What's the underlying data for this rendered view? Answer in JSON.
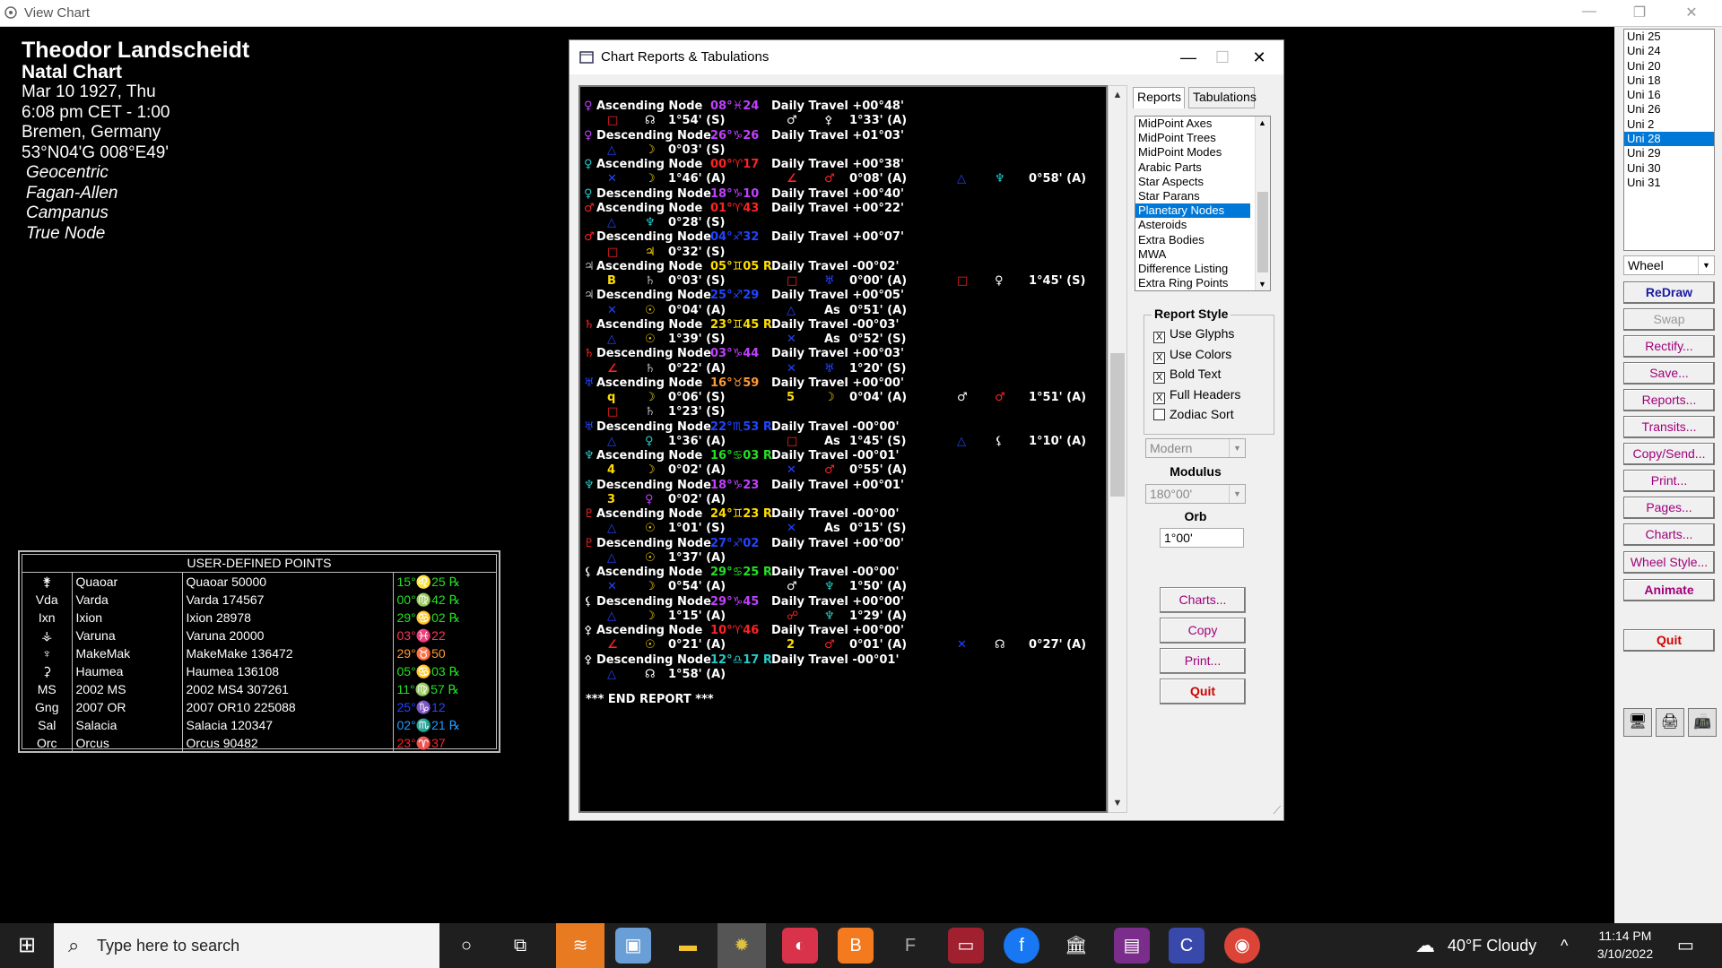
{
  "window": {
    "title": "View Chart"
  },
  "chart_info": {
    "name": "Theodor Landscheidt",
    "type": "Natal Chart",
    "date": "Mar 10 1927, Thu",
    "time": "6:08 pm  CET - 1:00",
    "place": "Bremen, Germany",
    "coords": "53°N04'G 008°E49'",
    "options": [
      "Geocentric",
      "Fagan-Allen",
      "Campanus",
      "True Node"
    ]
  },
  "udp": {
    "header": "USER-DEFINED POINTS",
    "rows": [
      {
        "abbr": "⚵",
        "name": "Quaoar",
        "full": "Quaoar 50000",
        "pos": "15°♌25 ℞",
        "color": "#22e022"
      },
      {
        "abbr": "Vda",
        "name": "Varda",
        "full": "Varda 174567",
        "pos": "00°♍42 ℞",
        "color": "#22e022"
      },
      {
        "abbr": "Ixn",
        "name": "Ixion",
        "full": "Ixion 28978",
        "pos": "29°♋02 ℞",
        "color": "#22e022"
      },
      {
        "abbr": "⚶",
        "name": "Varuna",
        "full": "Varuna 20000",
        "pos": "03°♓22",
        "color": "#ff3355"
      },
      {
        "abbr": "♆",
        "name": "MakeMak",
        "full": "MakeMake 136472",
        "pos": "29°♉50",
        "color": "#ff9933"
      },
      {
        "abbr": "⚳",
        "name": "Haumea",
        "full": "Haumea 136108",
        "pos": "05°♋03 ℞",
        "color": "#22e022"
      },
      {
        "abbr": "MS",
        "name": "2002 MS",
        "full": "2002 MS4 307261",
        "pos": "11°♍57 ℞",
        "color": "#22e022"
      },
      {
        "abbr": "Gng",
        "name": "2007 OR",
        "full": "2007 OR10 225088",
        "pos": "25°♑12",
        "color": "#2244ff"
      },
      {
        "abbr": "Sal",
        "name": "Salacia",
        "full": "Salacia 120347",
        "pos": "02°♏21 ℞",
        "color": "#2299ff"
      },
      {
        "abbr": "Orc",
        "name": "Orcus",
        "full": "Orcus 90482",
        "pos": "23°♈37",
        "color": "#ff2222"
      }
    ]
  },
  "dialog": {
    "title": "Chart Reports & Tabulations",
    "tabs": [
      "Reports",
      "Tabulations"
    ],
    "report_types": [
      "MidPoint Axes",
      "MidPoint Trees",
      "MidPoint Modes",
      "Arabic Parts",
      "Star Aspects",
      "Star Parans",
      "Planetary Nodes",
      "Asteroids",
      "Extra Bodies",
      "MWA",
      "Difference Listing",
      "Extra Ring Points"
    ],
    "selected_report": "Planetary Nodes",
    "report_style_title": "Report Style",
    "checkboxes": [
      {
        "label": "Use Glyphs",
        "checked": "X"
      },
      {
        "label": "Use Colors",
        "checked": "X"
      },
      {
        "label": "Bold Text",
        "checked": "X"
      },
      {
        "label": "Full Headers",
        "checked": "X"
      },
      {
        "label": "Zodiac Sort",
        "checked": ""
      }
    ],
    "style_combo": "Modern",
    "modulus_label": "Modulus",
    "modulus_value": "180°00'",
    "orb_label": "Orb",
    "orb_value": "1°00'",
    "buttons": [
      "Charts...",
      "Copy",
      "Print...",
      "Quit"
    ],
    "end_text": "*** END REPORT ***"
  },
  "report_rows": [
    [
      {
        "t": "♀",
        "c": "#c040ff"
      },
      {
        "t": "Ascending Node",
        "c": "#fff"
      },
      {
        "t": "08°♓24",
        "c": "#c040ff"
      },
      {
        "t": "Daily Travel +00°48'",
        "c": "#fff"
      }
    ],
    [
      {
        "t": "□",
        "c": "#ff2222"
      },
      {
        "t": "☊",
        "c": "#fff"
      },
      {
        "t": "1°54' (S)",
        "c": "#fff"
      },
      {
        "t": "♂",
        "c": "#fff"
      },
      {
        "t": "⚴",
        "c": "#fff"
      },
      {
        "t": "1°33' (A)",
        "c": "#fff"
      }
    ],
    [
      {
        "t": "♀",
        "c": "#c040ff"
      },
      {
        "t": "Descending Node",
        "c": "#fff"
      },
      {
        "t": "26°♑26",
        "c": "#c040ff"
      },
      {
        "t": "Daily Travel +01°03'",
        "c": "#fff"
      }
    ],
    [
      {
        "t": "△",
        "c": "#2244ff"
      },
      {
        "t": "☽",
        "c": "#ffdd00"
      },
      {
        "t": "0°03' (S)",
        "c": "#fff"
      }
    ],
    [
      {
        "t": "♀",
        "c": "#22cccc"
      },
      {
        "t": "Ascending Node",
        "c": "#fff"
      },
      {
        "t": "00°♈17",
        "c": "#ff2222"
      },
      {
        "t": "Daily Travel +00°38'",
        "c": "#fff"
      }
    ],
    [
      {
        "t": "✕",
        "c": "#2244ff"
      },
      {
        "t": "☽",
        "c": "#ffdd00"
      },
      {
        "t": "1°46' (A)",
        "c": "#fff"
      },
      {
        "t": "∠",
        "c": "#ff2222"
      },
      {
        "t": "♂",
        "c": "#ff2222"
      },
      {
        "t": "0°08' (A)",
        "c": "#fff"
      },
      {
        "t": "△",
        "c": "#2244ff"
      },
      {
        "t": "♆",
        "c": "#22cccc"
      },
      {
        "t": "0°58' (A)",
        "c": "#fff"
      }
    ],
    [
      {
        "t": "♀",
        "c": "#22cccc"
      },
      {
        "t": "Descending Node",
        "c": "#fff"
      },
      {
        "t": "18°♑10",
        "c": "#c040ff"
      },
      {
        "t": "Daily Travel +00°40'",
        "c": "#fff"
      }
    ],
    [
      {
        "t": "♂",
        "c": "#ff2222"
      },
      {
        "t": "Ascending Node",
        "c": "#fff"
      },
      {
        "t": "01°♈43",
        "c": "#ff2222"
      },
      {
        "t": "Daily Travel +00°22'",
        "c": "#fff"
      }
    ],
    [
      {
        "t": "△",
        "c": "#2244ff"
      },
      {
        "t": "♆",
        "c": "#22cccc"
      },
      {
        "t": "0°28' (S)",
        "c": "#fff"
      }
    ],
    [
      {
        "t": "♂",
        "c": "#ff2222"
      },
      {
        "t": "Descending Node",
        "c": "#fff"
      },
      {
        "t": "04°♐32",
        "c": "#2244ff"
      },
      {
        "t": "Daily Travel +00°07'",
        "c": "#fff"
      }
    ],
    [
      {
        "t": "□",
        "c": "#ff2222"
      },
      {
        "t": "♃",
        "c": "#ffdd00"
      },
      {
        "t": "0°32' (S)",
        "c": "#fff"
      }
    ],
    [
      {
        "t": "♃",
        "c": "#bbbbbb"
      },
      {
        "t": "Ascending Node",
        "c": "#fff"
      },
      {
        "t": "05°♊05 R",
        "c": "#ffdd00"
      },
      {
        "t": "Daily Travel -00°02'",
        "c": "#fff"
      }
    ],
    [
      {
        "t": "B",
        "c": "#ffdd00"
      },
      {
        "t": "♄",
        "c": "#bbbbbb"
      },
      {
        "t": "0°03' (S)",
        "c": "#fff"
      },
      {
        "t": "□",
        "c": "#ff2222"
      },
      {
        "t": "♅",
        "c": "#2244ff"
      },
      {
        "t": "0°00' (A)",
        "c": "#fff"
      },
      {
        "t": "□",
        "c": "#ff2222"
      },
      {
        "t": "♀",
        "c": "#fff"
      },
      {
        "t": "1°45' (S)",
        "c": "#fff"
      }
    ],
    [
      {
        "t": "♃",
        "c": "#bbbbbb"
      },
      {
        "t": "Descending Node",
        "c": "#fff"
      },
      {
        "t": "25°♐29",
        "c": "#2244ff"
      },
      {
        "t": "Daily Travel +00°05'",
        "c": "#fff"
      }
    ],
    [
      {
        "t": "✕",
        "c": "#2244ff"
      },
      {
        "t": "☉",
        "c": "#ffdd00"
      },
      {
        "t": "0°04' (A)",
        "c": "#fff"
      },
      {
        "t": "△",
        "c": "#2244ff"
      },
      {
        "t": "As",
        "c": "#fff"
      },
      {
        "t": "0°51' (A)",
        "c": "#fff"
      }
    ],
    [
      {
        "t": "♄",
        "c": "#ff2222"
      },
      {
        "t": "Ascending Node",
        "c": "#fff"
      },
      {
        "t": "23°♊45 R",
        "c": "#ffdd00"
      },
      {
        "t": "Daily Travel -00°03'",
        "c": "#fff"
      }
    ],
    [
      {
        "t": "△",
        "c": "#2244ff"
      },
      {
        "t": "☉",
        "c": "#ffdd00"
      },
      {
        "t": "1°39' (S)",
        "c": "#fff"
      },
      {
        "t": "✕",
        "c": "#2244ff"
      },
      {
        "t": "As",
        "c": "#fff"
      },
      {
        "t": "0°52' (S)",
        "c": "#fff"
      }
    ],
    [
      {
        "t": "♄",
        "c": "#ff2222"
      },
      {
        "t": "Descending Node",
        "c": "#fff"
      },
      {
        "t": "03°♑44",
        "c": "#c040ff"
      },
      {
        "t": "Daily Travel +00°03'",
        "c": "#fff"
      }
    ],
    [
      {
        "t": "∠",
        "c": "#ff2222"
      },
      {
        "t": "♄",
        "c": "#bbbbbb"
      },
      {
        "t": "0°22' (A)",
        "c": "#fff"
      },
      {
        "t": "✕",
        "c": "#2244ff"
      },
      {
        "t": "♅",
        "c": "#2244ff"
      },
      {
        "t": "1°20' (S)",
        "c": "#fff"
      }
    ],
    [
      {
        "t": "♅",
        "c": "#2244ff"
      },
      {
        "t": "Ascending Node",
        "c": "#fff"
      },
      {
        "t": "16°♉59",
        "c": "#ff9933"
      },
      {
        "t": "Daily Travel +00°00'",
        "c": "#fff"
      }
    ],
    [
      {
        "t": "q",
        "c": "#ffdd00"
      },
      {
        "t": "☽",
        "c": "#ffdd00"
      },
      {
        "t": "0°06' (S)",
        "c": "#fff"
      },
      {
        "t": "5",
        "c": "#ffdd00"
      },
      {
        "t": "☽",
        "c": "#ffdd00"
      },
      {
        "t": "0°04' (A)",
        "c": "#fff"
      },
      {
        "t": "♂",
        "c": "#fff"
      },
      {
        "t": "♂",
        "c": "#ff2222"
      },
      {
        "t": "1°51' (A)",
        "c": "#fff"
      }
    ],
    [
      {
        "t": "□",
        "c": "#ff2222"
      },
      {
        "t": "♄",
        "c": "#bbbbbb"
      },
      {
        "t": "1°23' (S)",
        "c": "#fff"
      }
    ],
    [
      {
        "t": "♅",
        "c": "#2244ff"
      },
      {
        "t": "Descending Node",
        "c": "#fff"
      },
      {
        "t": "22°♏53 R",
        "c": "#2244ff"
      },
      {
        "t": "Daily Travel -00°00'",
        "c": "#fff"
      }
    ],
    [
      {
        "t": "△",
        "c": "#2244ff"
      },
      {
        "t": "♀",
        "c": "#22cccc"
      },
      {
        "t": "1°36' (A)",
        "c": "#fff"
      },
      {
        "t": "□",
        "c": "#ff2222"
      },
      {
        "t": "As",
        "c": "#fff"
      },
      {
        "t": "1°45' (S)",
        "c": "#fff"
      },
      {
        "t": "△",
        "c": "#2244ff"
      },
      {
        "t": "⚸",
        "c": "#fff"
      },
      {
        "t": "1°10' (A)",
        "c": "#fff"
      }
    ],
    [
      {
        "t": "♆",
        "c": "#22cccc"
      },
      {
        "t": "Ascending Node",
        "c": "#fff"
      },
      {
        "t": "16°♋03 R",
        "c": "#22e022"
      },
      {
        "t": "Daily Travel -00°01'",
        "c": "#fff"
      }
    ],
    [
      {
        "t": "4",
        "c": "#ffdd00"
      },
      {
        "t": "☽",
        "c": "#ffdd00"
      },
      {
        "t": "0°02' (A)",
        "c": "#fff"
      },
      {
        "t": "✕",
        "c": "#2244ff"
      },
      {
        "t": "♂",
        "c": "#ff2222"
      },
      {
        "t": "0°55' (A)",
        "c": "#fff"
      }
    ],
    [
      {
        "t": "♆",
        "c": "#22cccc"
      },
      {
        "t": "Descending Node",
        "c": "#fff"
      },
      {
        "t": "18°♑23",
        "c": "#c040ff"
      },
      {
        "t": "Daily Travel +00°01'",
        "c": "#fff"
      }
    ],
    [
      {
        "t": "3",
        "c": "#ffdd00"
      },
      {
        "t": "♀",
        "c": "#c040ff"
      },
      {
        "t": "0°02' (A)",
        "c": "#fff"
      }
    ],
    [
      {
        "t": "♇",
        "c": "#ff2222"
      },
      {
        "t": "Ascending Node",
        "c": "#fff"
      },
      {
        "t": "24°♊23 R",
        "c": "#ffdd00"
      },
      {
        "t": "Daily Travel -00°00'",
        "c": "#fff"
      }
    ],
    [
      {
        "t": "△",
        "c": "#2244ff"
      },
      {
        "t": "☉",
        "c": "#ffdd00"
      },
      {
        "t": "1°01' (S)",
        "c": "#fff"
      },
      {
        "t": "✕",
        "c": "#2244ff"
      },
      {
        "t": "As",
        "c": "#fff"
      },
      {
        "t": "0°15' (S)",
        "c": "#fff"
      }
    ],
    [
      {
        "t": "♇",
        "c": "#ff2222"
      },
      {
        "t": "Descending Node",
        "c": "#fff"
      },
      {
        "t": "27°♐02",
        "c": "#2244ff"
      },
      {
        "t": "Daily Travel +00°00'",
        "c": "#fff"
      }
    ],
    [
      {
        "t": "△",
        "c": "#2244ff"
      },
      {
        "t": "☉",
        "c": "#ffdd00"
      },
      {
        "t": "1°37' (A)",
        "c": "#fff"
      }
    ],
    [
      {
        "t": "⚸",
        "c": "#fff"
      },
      {
        "t": "Ascending Node",
        "c": "#fff"
      },
      {
        "t": "29°♋25 R",
        "c": "#22e022"
      },
      {
        "t": "Daily Travel -00°00'",
        "c": "#fff"
      }
    ],
    [
      {
        "t": "✕",
        "c": "#2244ff"
      },
      {
        "t": "☽",
        "c": "#ffdd00"
      },
      {
        "t": "0°54' (A)",
        "c": "#fff"
      },
      {
        "t": "♂",
        "c": "#fff"
      },
      {
        "t": "♆",
        "c": "#22cccc"
      },
      {
        "t": "1°50' (A)",
        "c": "#fff"
      }
    ],
    [
      {
        "t": "⚸",
        "c": "#fff"
      },
      {
        "t": "Descending Node",
        "c": "#fff"
      },
      {
        "t": "29°♑45",
        "c": "#c040ff"
      },
      {
        "t": "Daily Travel +00°00'",
        "c": "#fff"
      }
    ],
    [
      {
        "t": "△",
        "c": "#2244ff"
      },
      {
        "t": "☽",
        "c": "#ffdd00"
      },
      {
        "t": "1°15' (A)",
        "c": "#fff"
      },
      {
        "t": "☍",
        "c": "#ff2222"
      },
      {
        "t": "♆",
        "c": "#22cccc"
      },
      {
        "t": "1°29' (A)",
        "c": "#fff"
      }
    ],
    [
      {
        "t": "⚴",
        "c": "#fff"
      },
      {
        "t": "Ascending Node",
        "c": "#fff"
      },
      {
        "t": "10°♈46",
        "c": "#ff2222"
      },
      {
        "t": "Daily Travel +00°00'",
        "c": "#fff"
      }
    ],
    [
      {
        "t": "∠",
        "c": "#ff2222"
      },
      {
        "t": "☉",
        "c": "#ffdd00"
      },
      {
        "t": "0°21' (A)",
        "c": "#fff"
      },
      {
        "t": "2",
        "c": "#ffdd00"
      },
      {
        "t": "♂",
        "c": "#ff2222"
      },
      {
        "t": "0°01' (A)",
        "c": "#fff"
      },
      {
        "t": "✕",
        "c": "#2244ff"
      },
      {
        "t": "☊",
        "c": "#fff"
      },
      {
        "t": "0°27' (A)",
        "c": "#fff"
      }
    ],
    [
      {
        "t": "⚴",
        "c": "#fff"
      },
      {
        "t": "Descending Node",
        "c": "#fff"
      },
      {
        "t": "12°♎17 R",
        "c": "#22cccc"
      },
      {
        "t": "Daily Travel -00°01'",
        "c": "#fff"
      }
    ],
    [
      {
        "t": "△",
        "c": "#2244ff"
      },
      {
        "t": "☊",
        "c": "#fff"
      },
      {
        "t": "1°58' (A)",
        "c": "#fff"
      }
    ]
  ],
  "right_panel": {
    "uni_list": [
      "Uni 25",
      "Uni 24",
      "Uni 20",
      "Uni 18",
      "Uni 16",
      "Uni 26",
      "Uni 2",
      "Uni 28",
      "Uni 29",
      "Uni 30",
      "Uni 31"
    ],
    "uni_selected": "Uni 28",
    "view_combo": "Wheel",
    "buttons": [
      {
        "label": "ReDraw",
        "style": "bold"
      },
      {
        "label": "Swap",
        "style": "dis"
      },
      {
        "label": "Rectify...",
        "style": ""
      },
      {
        "label": "Save...",
        "style": ""
      },
      {
        "label": "Reports...",
        "style": ""
      },
      {
        "label": "Transits...",
        "style": ""
      },
      {
        "label": "Copy/Send...",
        "style": ""
      },
      {
        "label": "Print...",
        "style": ""
      },
      {
        "label": "Pages...",
        "style": ""
      },
      {
        "label": "Charts...",
        "style": ""
      },
      {
        "label": "Wheel Style...",
        "style": ""
      },
      {
        "label": "Animate",
        "style": "anim"
      },
      {
        "label": "Quit",
        "style": "red"
      }
    ]
  },
  "taskbar": {
    "search_placeholder": "Type here to search",
    "weather": "40°F  Cloudy",
    "time": "11:14 PM",
    "date": "3/10/2022"
  }
}
